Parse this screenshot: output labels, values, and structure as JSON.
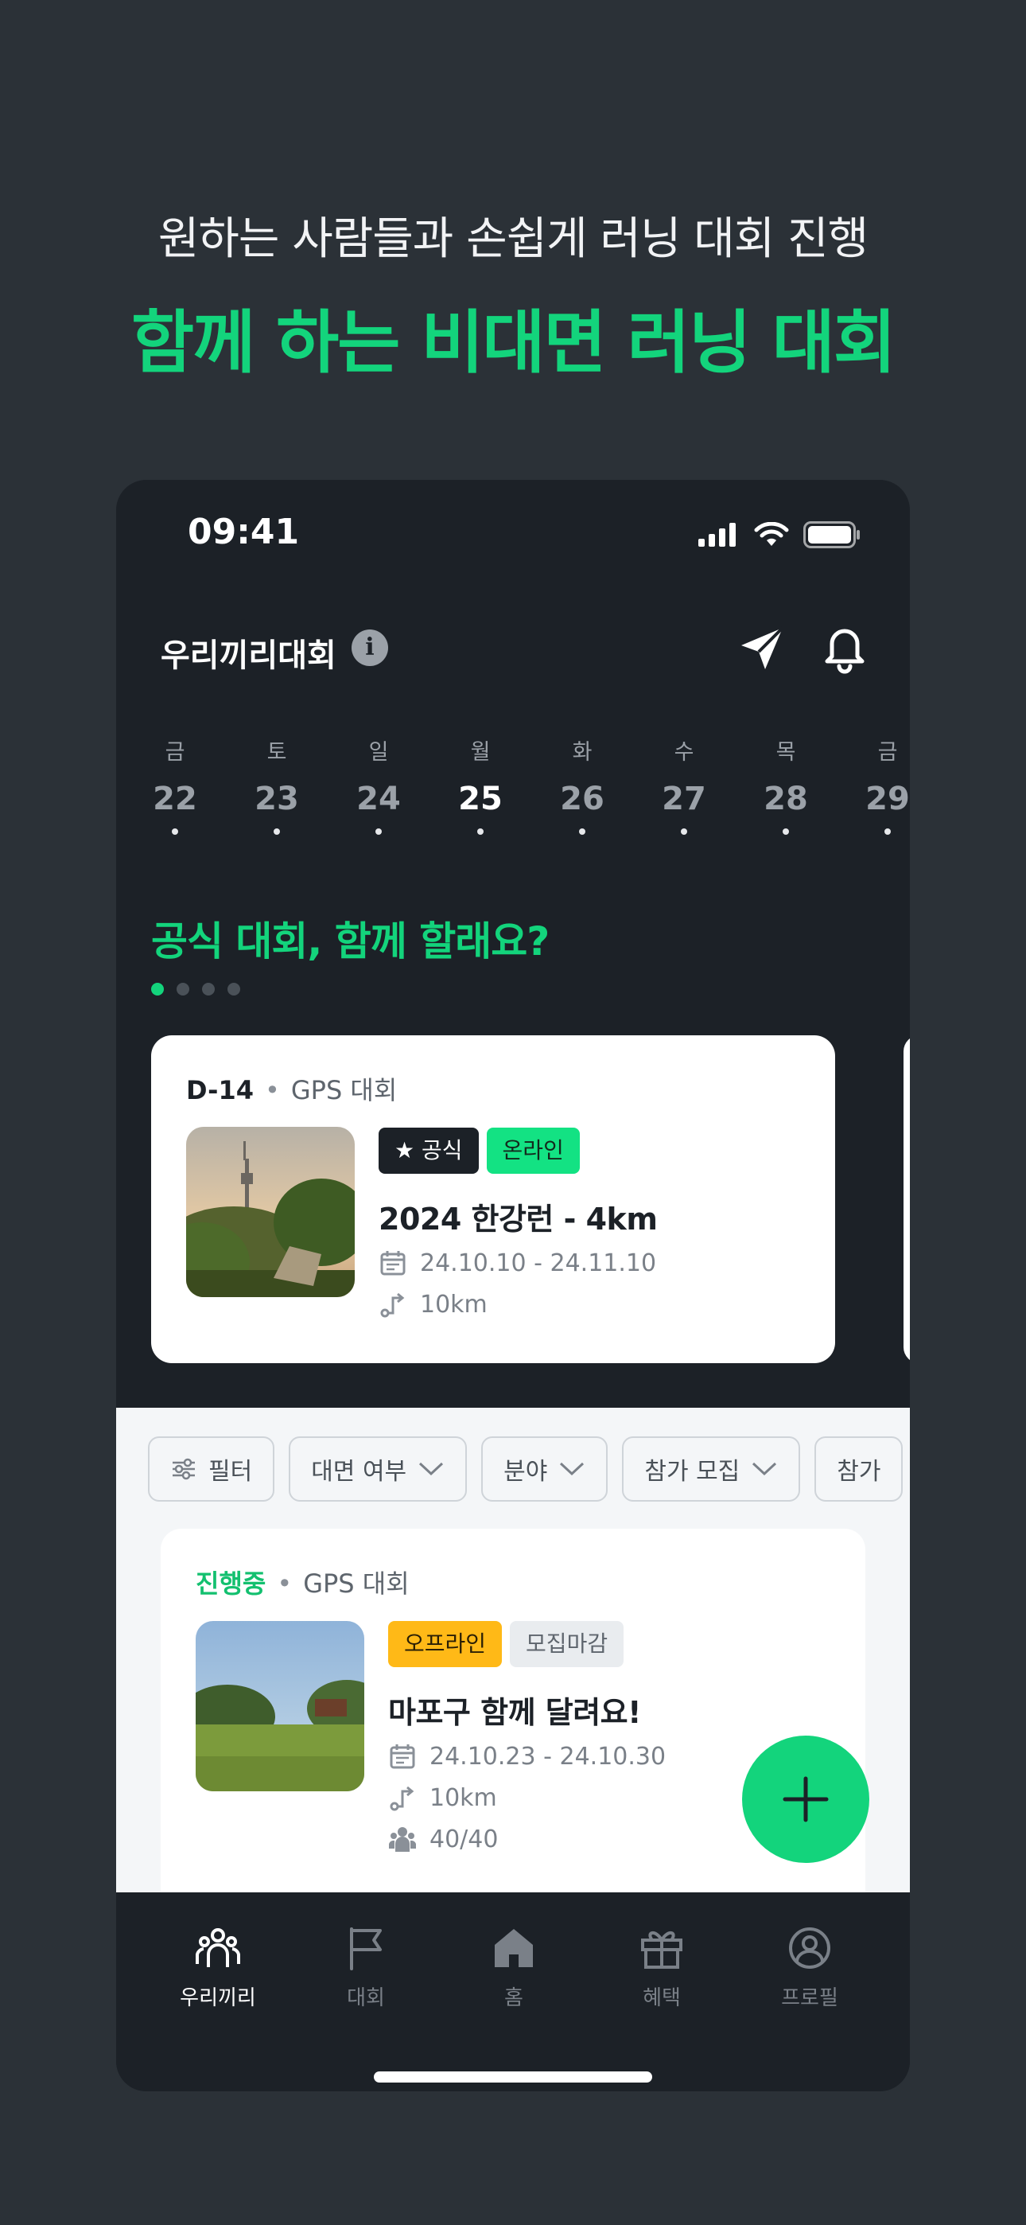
{
  "promo": {
    "subtitle": "원하는 사람들과 손쉽게 러닝 대회 진행",
    "title": "함께 하는 비대면 러닝 대회"
  },
  "status_bar": {
    "time": "09:41"
  },
  "app_bar": {
    "title": "우리끼리대회",
    "info_icon": "info-icon",
    "send_icon": "paper-plane-icon",
    "bell_icon": "bell-icon"
  },
  "calendar": {
    "days": [
      {
        "dow": "금",
        "num": "22"
      },
      {
        "dow": "토",
        "num": "23"
      },
      {
        "dow": "일",
        "num": "24"
      },
      {
        "dow": "월",
        "num": "25"
      },
      {
        "dow": "화",
        "num": "26"
      },
      {
        "dow": "수",
        "num": "27"
      },
      {
        "dow": "목",
        "num": "28"
      },
      {
        "dow": "금",
        "num": "29"
      }
    ],
    "selected": "25"
  },
  "official": {
    "heading": "공식 대회, 함께 할래요?",
    "pager_total": 4,
    "pager_current": 1,
    "card": {
      "dday": "D-14",
      "separator": "•",
      "type": "GPS 대회",
      "tag_official": "공식",
      "tag_online": "온라인",
      "title": "2024 한강런 - 4km",
      "dates": "24.10.10 - 24.11.10",
      "distance": "10km"
    }
  },
  "filters": {
    "filter_label": "필터",
    "chips": [
      "대면 여부",
      "분야",
      "참가 모집",
      "참가"
    ]
  },
  "list_card": {
    "status": "진행중",
    "separator": "•",
    "type": "GPS 대회",
    "tag_offline": "오프라인",
    "tag_closed": "모집마감",
    "title": "마포구 함께 달려요!",
    "dates": "24.10.23 - 24.10.30",
    "distance": "10km",
    "participants": "40/40"
  },
  "tabbar": {
    "items": [
      {
        "label": "우리끼리",
        "icon": "people-icon"
      },
      {
        "label": "대회",
        "icon": "flag-icon"
      },
      {
        "label": "홈",
        "icon": "home-icon"
      },
      {
        "label": "혜택",
        "icon": "gift-icon"
      },
      {
        "label": "프로필",
        "icon": "profile-icon"
      }
    ]
  },
  "colors": {
    "accent": "#13d47c",
    "background": "#2b3137",
    "phone_background": "#1c2127",
    "tag_offline": "#ffb917"
  }
}
